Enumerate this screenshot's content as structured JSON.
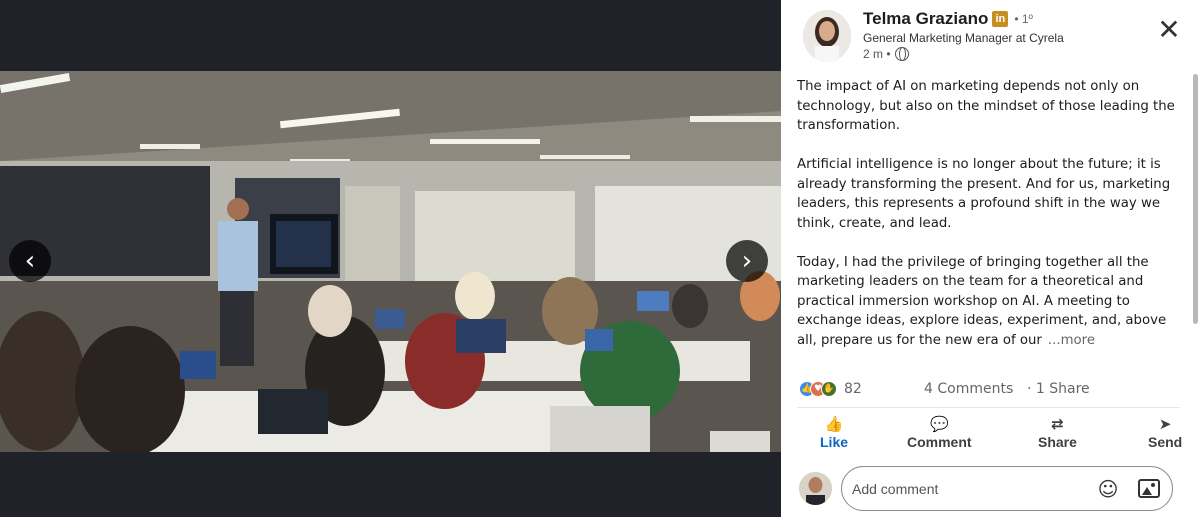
{
  "viewer": {
    "prev_icon": "chevron-left-icon",
    "next_icon": "chevron-right-icon",
    "prev_glyph": "‹",
    "next_glyph": "›"
  },
  "author": {
    "name": "Telma Graziano",
    "badge": "in",
    "degree": "• 1º",
    "headline": "General Marketing Manager at Cyrela",
    "time": "2 m •"
  },
  "close_glyph": "✕",
  "post": {
    "paragraphs": [
      "The impact of AI on marketing depends not only on technology, but also on the mindset of those leading the transformation.",
      "Artificial intelligence is no longer about the future; it is already transforming the present. And for us, marketing leaders, this represents a profound shift in the way we think, create, and lead."
    ],
    "last_paragraph": "Today, I had the privilege of bringing together all the marketing leaders on the team for a theoretical and practical immersion workshop on AI. A meeting to exchange ideas, explore ideas, experiment, and, above all, prepare us for the new era of our",
    "more_label": "...more"
  },
  "stats": {
    "reactions_count": "82",
    "comments": "4 Comments",
    "shares": "· 1 Share"
  },
  "actions": {
    "like": "Like",
    "comment": "Comment",
    "share": "Share",
    "send": "Send"
  },
  "comment_box": {
    "placeholder": "Add comment"
  },
  "colors": {
    "accent": "#0a66c2",
    "viewer_bg": "#1f2329",
    "badge": "#c58f22"
  }
}
